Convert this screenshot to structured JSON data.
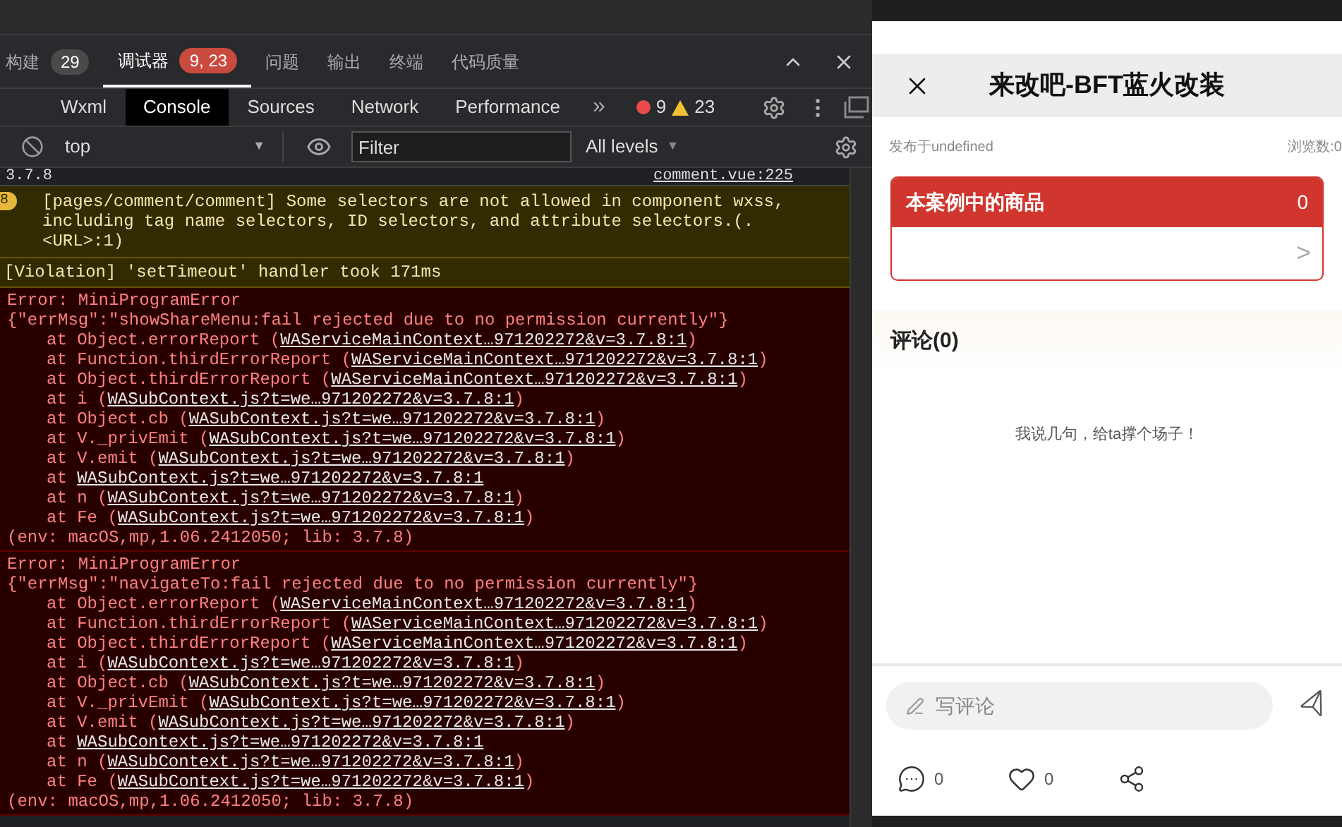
{
  "panel_tabs": [
    {
      "label": "构建",
      "badge": "29",
      "color": "#4a4a4a",
      "selected": false
    },
    {
      "label": "调试器",
      "badge": "9, 23",
      "color": "#c94a3f",
      "selected": true
    },
    {
      "label": "问题",
      "selected": false
    },
    {
      "label": "输出",
      "selected": false
    },
    {
      "label": "终端",
      "selected": false
    },
    {
      "label": "代码质量",
      "selected": false
    }
  ],
  "devtools_tabs": [
    {
      "label": "Wxml",
      "selected": false
    },
    {
      "label": "Console",
      "selected": true
    },
    {
      "label": "Sources",
      "selected": false
    },
    {
      "label": "Network",
      "selected": false
    },
    {
      "label": "Performance",
      "selected": false
    }
  ],
  "more_tabs": "»",
  "error_count": "9",
  "warning_count": "23",
  "console_toolbar": {
    "context": "top",
    "context_arrow": "▼",
    "filter_placeholder": "Filter",
    "levels": "All levels",
    "levels_arrow": "▼"
  },
  "messages": [
    {
      "kind": "tail",
      "text": "3.7.8",
      "source": "comment.vue:225"
    },
    {
      "kind": "warning",
      "count": "8",
      "lines": [
        "[pages/comment/comment] Some selectors are not allowed in component wxss,",
        "including tag name selectors, ID selectors, and attribute selectors.(.",
        "<URL>:1)"
      ]
    },
    {
      "kind": "violation",
      "lines": [
        "[Violation] 'setTimeout' handler took 171ms"
      ]
    },
    {
      "kind": "error",
      "title": "Error: MiniProgramError",
      "message": "{\"errMsg\":\"showShareMenu:fail rejected due to no permission currently\"}",
      "stack": [
        {
          "prefix": "at Object.errorReport (",
          "link": "WAServiceMainContext…971202272&v=3.7.8:1",
          "suffix": ")"
        },
        {
          "prefix": "at Function.thirdErrorReport (",
          "link": "WAServiceMainContext…971202272&v=3.7.8:1",
          "suffix": ")"
        },
        {
          "prefix": "at Object.thirdErrorReport (",
          "link": "WAServiceMainContext…971202272&v=3.7.8:1",
          "suffix": ")"
        },
        {
          "prefix": "at i (",
          "link": "WASubContext.js?t=we…971202272&v=3.7.8:1",
          "suffix": ")"
        },
        {
          "prefix": "at Object.cb (",
          "link": "WASubContext.js?t=we…971202272&v=3.7.8:1",
          "suffix": ")"
        },
        {
          "prefix": "at V._privEmit (",
          "link": "WASubContext.js?t=we…971202272&v=3.7.8:1",
          "suffix": ")"
        },
        {
          "prefix": "at V.emit (",
          "link": "WASubContext.js?t=we…971202272&v=3.7.8:1",
          "suffix": ")"
        },
        {
          "prefix": "at ",
          "link": "WASubContext.js?t=we…971202272&v=3.7.8:1"
        },
        {
          "prefix": "at n (",
          "link": "WASubContext.js?t=we…971202272&v=3.7.8:1",
          "suffix": ")"
        },
        {
          "prefix": "at Fe (",
          "link": "WASubContext.js?t=we…971202272&v=3.7.8:1",
          "suffix": ")"
        }
      ],
      "env": "(env: macOS,mp,1.06.2412050; lib: 3.7.8)"
    },
    {
      "kind": "error",
      "title": "Error: MiniProgramError",
      "message": "{\"errMsg\":\"navigateTo:fail rejected due to no permission currently\"}",
      "stack": [
        {
          "prefix": "at Object.errorReport (",
          "link": "WAServiceMainContext…971202272&v=3.7.8:1",
          "suffix": ")"
        },
        {
          "prefix": "at Function.thirdErrorReport (",
          "link": "WAServiceMainContext…971202272&v=3.7.8:1",
          "suffix": ")"
        },
        {
          "prefix": "at Object.thirdErrorReport (",
          "link": "WAServiceMainContext…971202272&v=3.7.8:1",
          "suffix": ")"
        },
        {
          "prefix": "at i (",
          "link": "WASubContext.js?t=we…971202272&v=3.7.8:1",
          "suffix": ")"
        },
        {
          "prefix": "at Object.cb (",
          "link": "WASubContext.js?t=we…971202272&v=3.7.8:1",
          "suffix": ")"
        },
        {
          "prefix": "at V._privEmit (",
          "link": "WASubContext.js?t=we…971202272&v=3.7.8:1",
          "suffix": ")"
        },
        {
          "prefix": "at V.emit (",
          "link": "WASubContext.js?t=we…971202272&v=3.7.8:1",
          "suffix": ")"
        },
        {
          "prefix": "at ",
          "link": "WASubContext.js?t=we…971202272&v=3.7.8:1"
        },
        {
          "prefix": "at n (",
          "link": "WASubContext.js?t=we…971202272&v=3.7.8:1",
          "suffix": ")"
        },
        {
          "prefix": "at Fe (",
          "link": "WASubContext.js?t=we…971202272&v=3.7.8:1",
          "suffix": ")"
        }
      ],
      "env": "(env: macOS,mp,1.06.2412050; lib: 3.7.8)"
    }
  ],
  "phone": {
    "title": "来改吧-BFT蓝火改装",
    "published": "发布于undefined",
    "views": "浏览数:0",
    "products": {
      "title": "本案例中的商品",
      "count": "0",
      "arrow": ">"
    },
    "comments_heading": "评论(0)",
    "empty_text": "我说几句，给ta撑个场子！",
    "comment_input": {
      "placeholder": "写评论"
    },
    "actions": [
      {
        "kind": "comment",
        "count": "0"
      },
      {
        "kind": "like",
        "count": "0"
      },
      {
        "kind": "share"
      }
    ]
  }
}
